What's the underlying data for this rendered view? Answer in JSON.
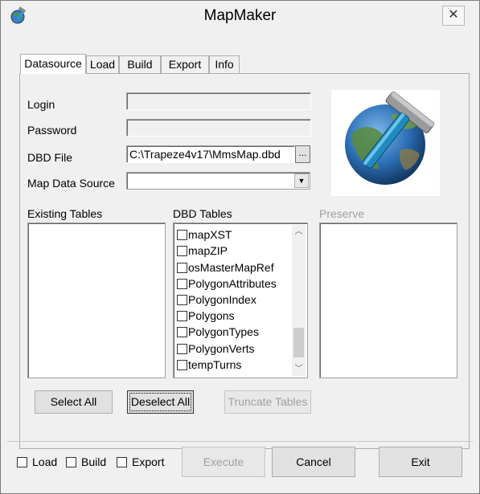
{
  "window": {
    "title": "MapMaker",
    "close_glyph": "✕",
    "app_icon": "map-maker-app-icon"
  },
  "tabs": [
    {
      "label": "Datasource",
      "active": true
    },
    {
      "label": "Load",
      "active": false
    },
    {
      "label": "Build",
      "active": false
    },
    {
      "label": "Export",
      "active": false
    },
    {
      "label": "Info",
      "active": false
    }
  ],
  "form": {
    "login_label": "Login",
    "login_value": "",
    "password_label": "Password",
    "password_value": "",
    "dbd_file_label": "DBD File",
    "dbd_file_value": "C:\\Trapeze4v17\\MmsMap.dbd",
    "browse_label": "...",
    "map_data_source_label": "Map Data Source",
    "map_data_source_value": ""
  },
  "logo": {
    "icon": "globe-hammer-icon"
  },
  "lists": {
    "existing_tables_label": "Existing Tables",
    "existing_tables": [],
    "dbd_tables_label": "DBD Tables",
    "dbd_tables": [
      {
        "label": "mapXST",
        "checked": false
      },
      {
        "label": "mapZIP",
        "checked": false
      },
      {
        "label": "osMasterMapRef",
        "checked": false
      },
      {
        "label": "PolygonAttributes",
        "checked": false
      },
      {
        "label": "PolygonIndex",
        "checked": false
      },
      {
        "label": "Polygons",
        "checked": false
      },
      {
        "label": "PolygonTypes",
        "checked": false
      },
      {
        "label": "PolygonVerts",
        "checked": false
      },
      {
        "label": "tempTurns",
        "checked": false
      }
    ],
    "preserve_label": "Preserve",
    "preserve": []
  },
  "buttons": {
    "select_all": "Select All",
    "deselect_all": "Deselect All",
    "truncate_tables": "Truncate Tables",
    "execute": "Execute",
    "cancel": "Cancel",
    "exit": "Exit"
  },
  "options": {
    "load_label": "Load",
    "build_label": "Build",
    "export_label": "Export"
  },
  "colors": {
    "window_bg": "#f0f0f0",
    "disabled_text": "#a0a0a0",
    "globe_blue": "#2b6fb6"
  }
}
